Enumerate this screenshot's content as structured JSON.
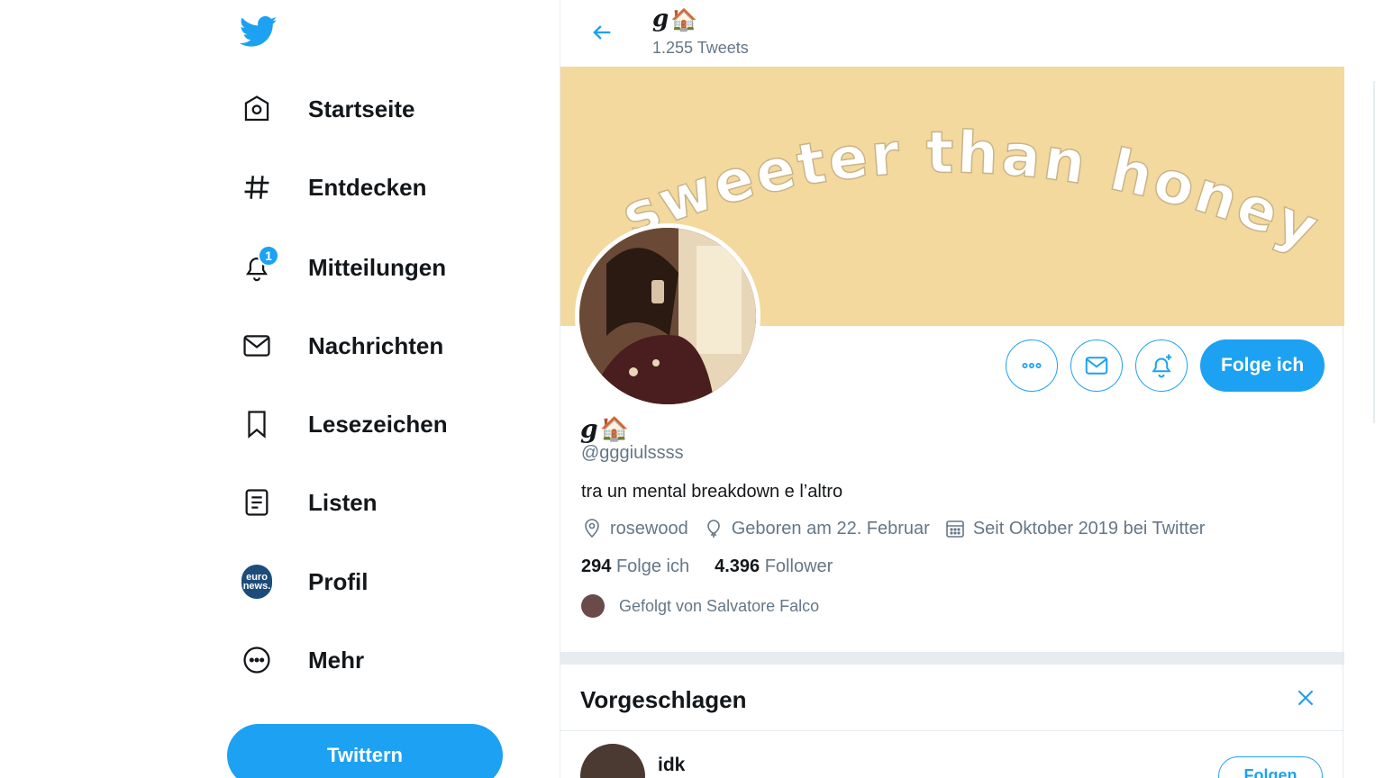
{
  "colors": {
    "accent": "#1da1f2",
    "banner": "#f3d99d",
    "text": "#14171a",
    "muted": "#657786"
  },
  "sidebar": {
    "logo_icon": "twitter-bird-icon",
    "items": [
      {
        "label": "Startseite",
        "icon": "home-icon"
      },
      {
        "label": "Entdecken",
        "icon": "hashtag-icon"
      },
      {
        "label": "Mitteilungen",
        "icon": "bell-icon",
        "badge": "1"
      },
      {
        "label": "Nachrichten",
        "icon": "mail-icon"
      },
      {
        "label": "Lesezeichen",
        "icon": "bookmark-icon"
      },
      {
        "label": "Listen",
        "icon": "list-icon"
      },
      {
        "label": "Profil",
        "icon": "avatar",
        "avatar_text": "euro news."
      },
      {
        "label": "Mehr",
        "icon": "more-icon"
      }
    ],
    "tweet_button": "Twittern"
  },
  "header": {
    "name": "g",
    "name_emoji": "🏠",
    "tweet_count": "1.255 Tweets"
  },
  "banner": {
    "text": "sweeter than honey"
  },
  "profile": {
    "display_name": "g",
    "name_emoji": "🏠",
    "handle": "@gggiulssss",
    "bio": "tra un mental breakdown e l’altro",
    "location": "rosewood",
    "birthday": "Geboren am 22. Februar",
    "joined": "Seit Oktober 2019 bei Twitter",
    "following_count": "294",
    "following_label": "Folge ich",
    "followers_count": "4.396",
    "followers_label": "Follower",
    "followed_by": "Gefolgt von Salvatore Falco",
    "follow_button": "Folge ich"
  },
  "suggested": {
    "title": "Vorgeschlagen",
    "items": [
      {
        "name": "idk",
        "button": "Folgen"
      }
    ]
  }
}
